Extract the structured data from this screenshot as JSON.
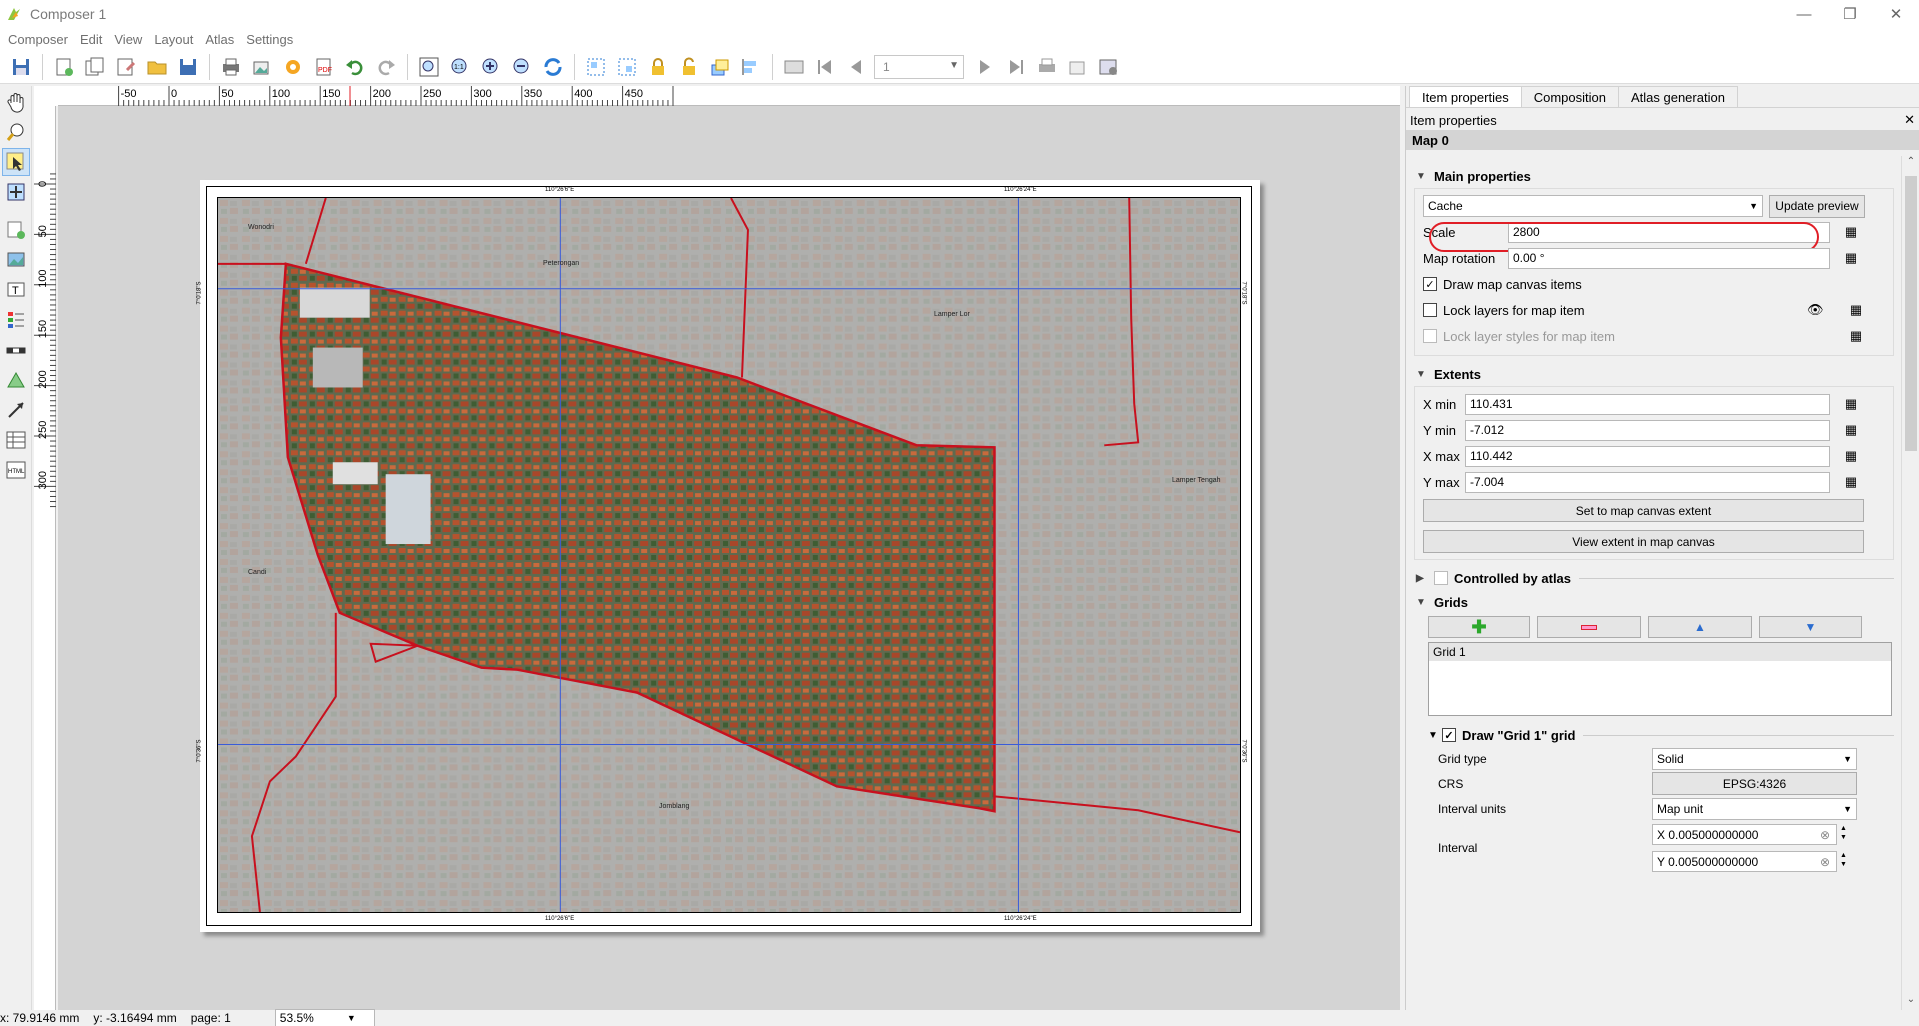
{
  "window": {
    "title": "Composer 1",
    "controls": [
      "minimize-icon",
      "restore-icon",
      "close-icon"
    ]
  },
  "menu": [
    "Composer",
    "Edit",
    "View",
    "Layout",
    "Atlas",
    "Settings"
  ],
  "toolbar": {
    "page_number": "1"
  },
  "rulers": {
    "horizontal": [
      "-50",
      "0",
      "50",
      "100",
      "150",
      "200",
      "250",
      "300",
      "350",
      "400",
      "450"
    ],
    "vertical": [
      "0",
      "50",
      "100",
      "150",
      "200",
      "250",
      "300"
    ]
  },
  "map": {
    "grid_labels_top": [
      "110°26'6\"E",
      "110°26'24\"E"
    ],
    "grid_labels_bottom": [
      "110°26'6\"E",
      "110°26'24\"E"
    ],
    "grid_labels_left": [
      "7°0'18\"S",
      "7°0'36\"S"
    ],
    "grid_labels_right": [
      "7°0'18\"S",
      "7°0'36\"S"
    ],
    "place_names": [
      "Wonodri",
      "Peterongan",
      "Lamper Lor",
      "Lamper Tengah",
      "Candi",
      "Jomblang"
    ]
  },
  "panel": {
    "tabs": [
      "Item properties",
      "Composition",
      "Atlas generation"
    ],
    "active_tab": "Item properties",
    "dock_title": "Item properties",
    "item_name": "Map 0",
    "main_properties": {
      "heading": "Main properties",
      "cache_mode": "Cache",
      "update_preview": "Update preview",
      "scale_label": "Scale",
      "scale_value": "2800",
      "rotation_label": "Map rotation",
      "rotation_value": "0.00 °",
      "draw_canvas_items": "Draw map canvas items",
      "draw_canvas_items_checked": true,
      "lock_layers": "Lock layers for map item",
      "lock_layers_checked": false,
      "lock_styles": "Lock layer styles for map item",
      "lock_styles_checked": false
    },
    "extents": {
      "heading": "Extents",
      "xmin_label": "X min",
      "xmin": "110.431",
      "ymin_label": "Y min",
      "ymin": "-7.012",
      "xmax_label": "X max",
      "xmax": "110.442",
      "ymax_label": "Y max",
      "ymax": "-7.004",
      "set_extent_btn": "Set to map canvas extent",
      "view_extent_btn": "View extent in map canvas"
    },
    "atlas": {
      "heading": "Controlled by atlas",
      "checked": false
    },
    "grids": {
      "heading": "Grids",
      "items": [
        "Grid 1"
      ],
      "draw_grid_heading": "Draw \"Grid 1\" grid",
      "draw_grid_checked": true,
      "grid_type_label": "Grid type",
      "grid_type": "Solid",
      "crs_label": "CRS",
      "crs": "EPSG:4326",
      "interval_units_label": "Interval units",
      "interval_units": "Map unit",
      "interval_label": "Interval",
      "interval_x": "X 0.005000000000",
      "interval_y": "Y 0.005000000000"
    }
  },
  "status": {
    "x": "x: 79.9146 mm",
    "y": "y: -3.16494 mm",
    "page": "page: 1",
    "zoom": "53.5%"
  },
  "colors": {
    "highlight": "#e01e26",
    "boundary": "#c8101e",
    "grid_lines": "#3a5bd9"
  }
}
